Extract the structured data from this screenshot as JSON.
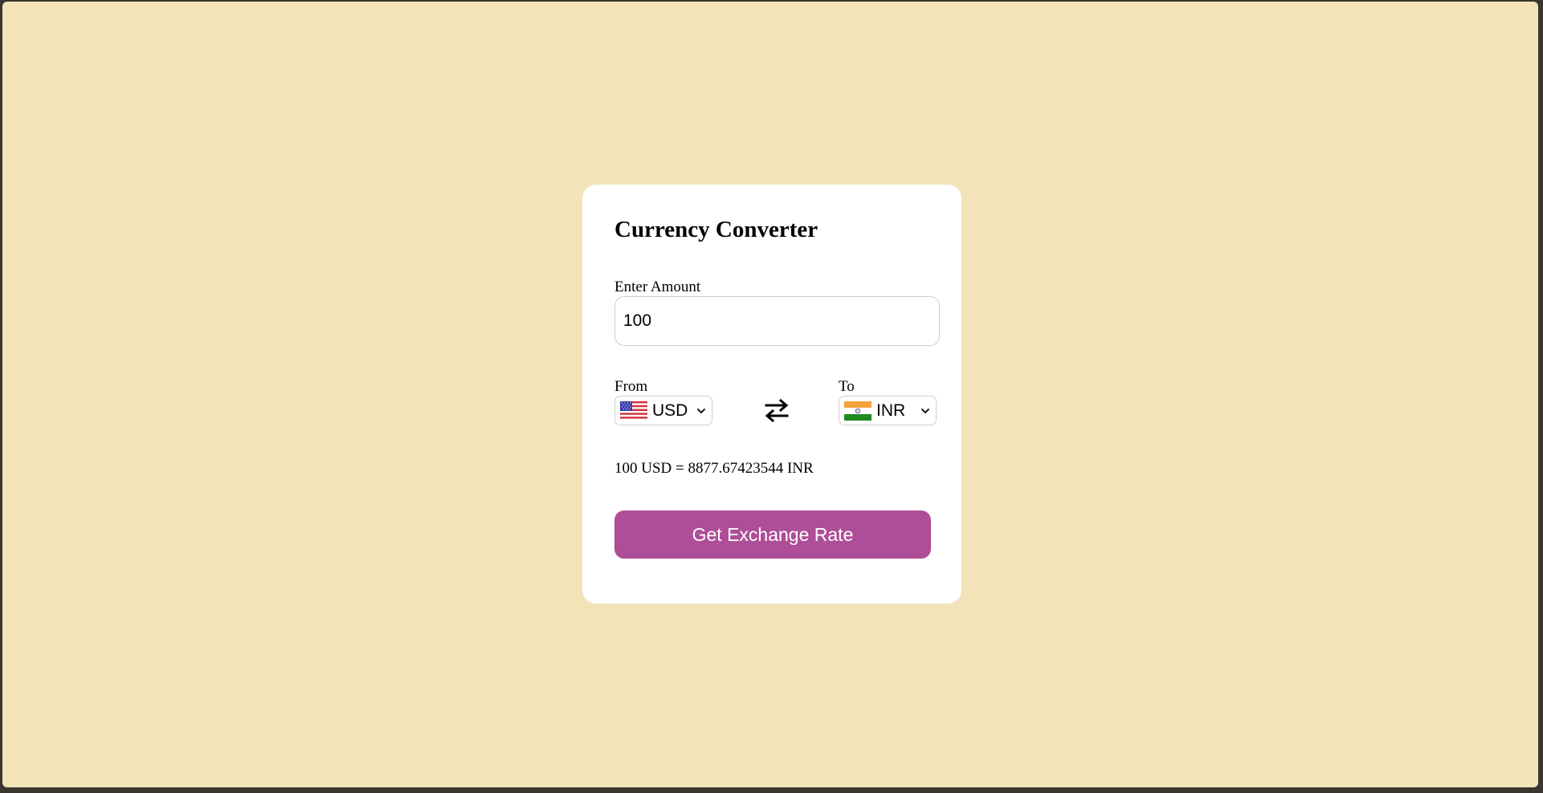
{
  "app": {
    "title": "Currency Converter"
  },
  "amount": {
    "label": "Enter Amount",
    "value": "100"
  },
  "from": {
    "label": "From",
    "currency": "USD",
    "flag_icon": "us-flag-icon"
  },
  "swap": {
    "icon": "swap-arrows-icon"
  },
  "to": {
    "label": "To",
    "currency": "INR",
    "flag_icon": "india-flag-icon"
  },
  "result": {
    "text": "100 USD = 8877.67423544 INR"
  },
  "action": {
    "button_label": "Get Exchange Rate"
  },
  "colors": {
    "page_background": "#f2e3b9",
    "card_background": "#ffffff",
    "button_background": "#ae4e98",
    "button_text": "#ffffff"
  }
}
